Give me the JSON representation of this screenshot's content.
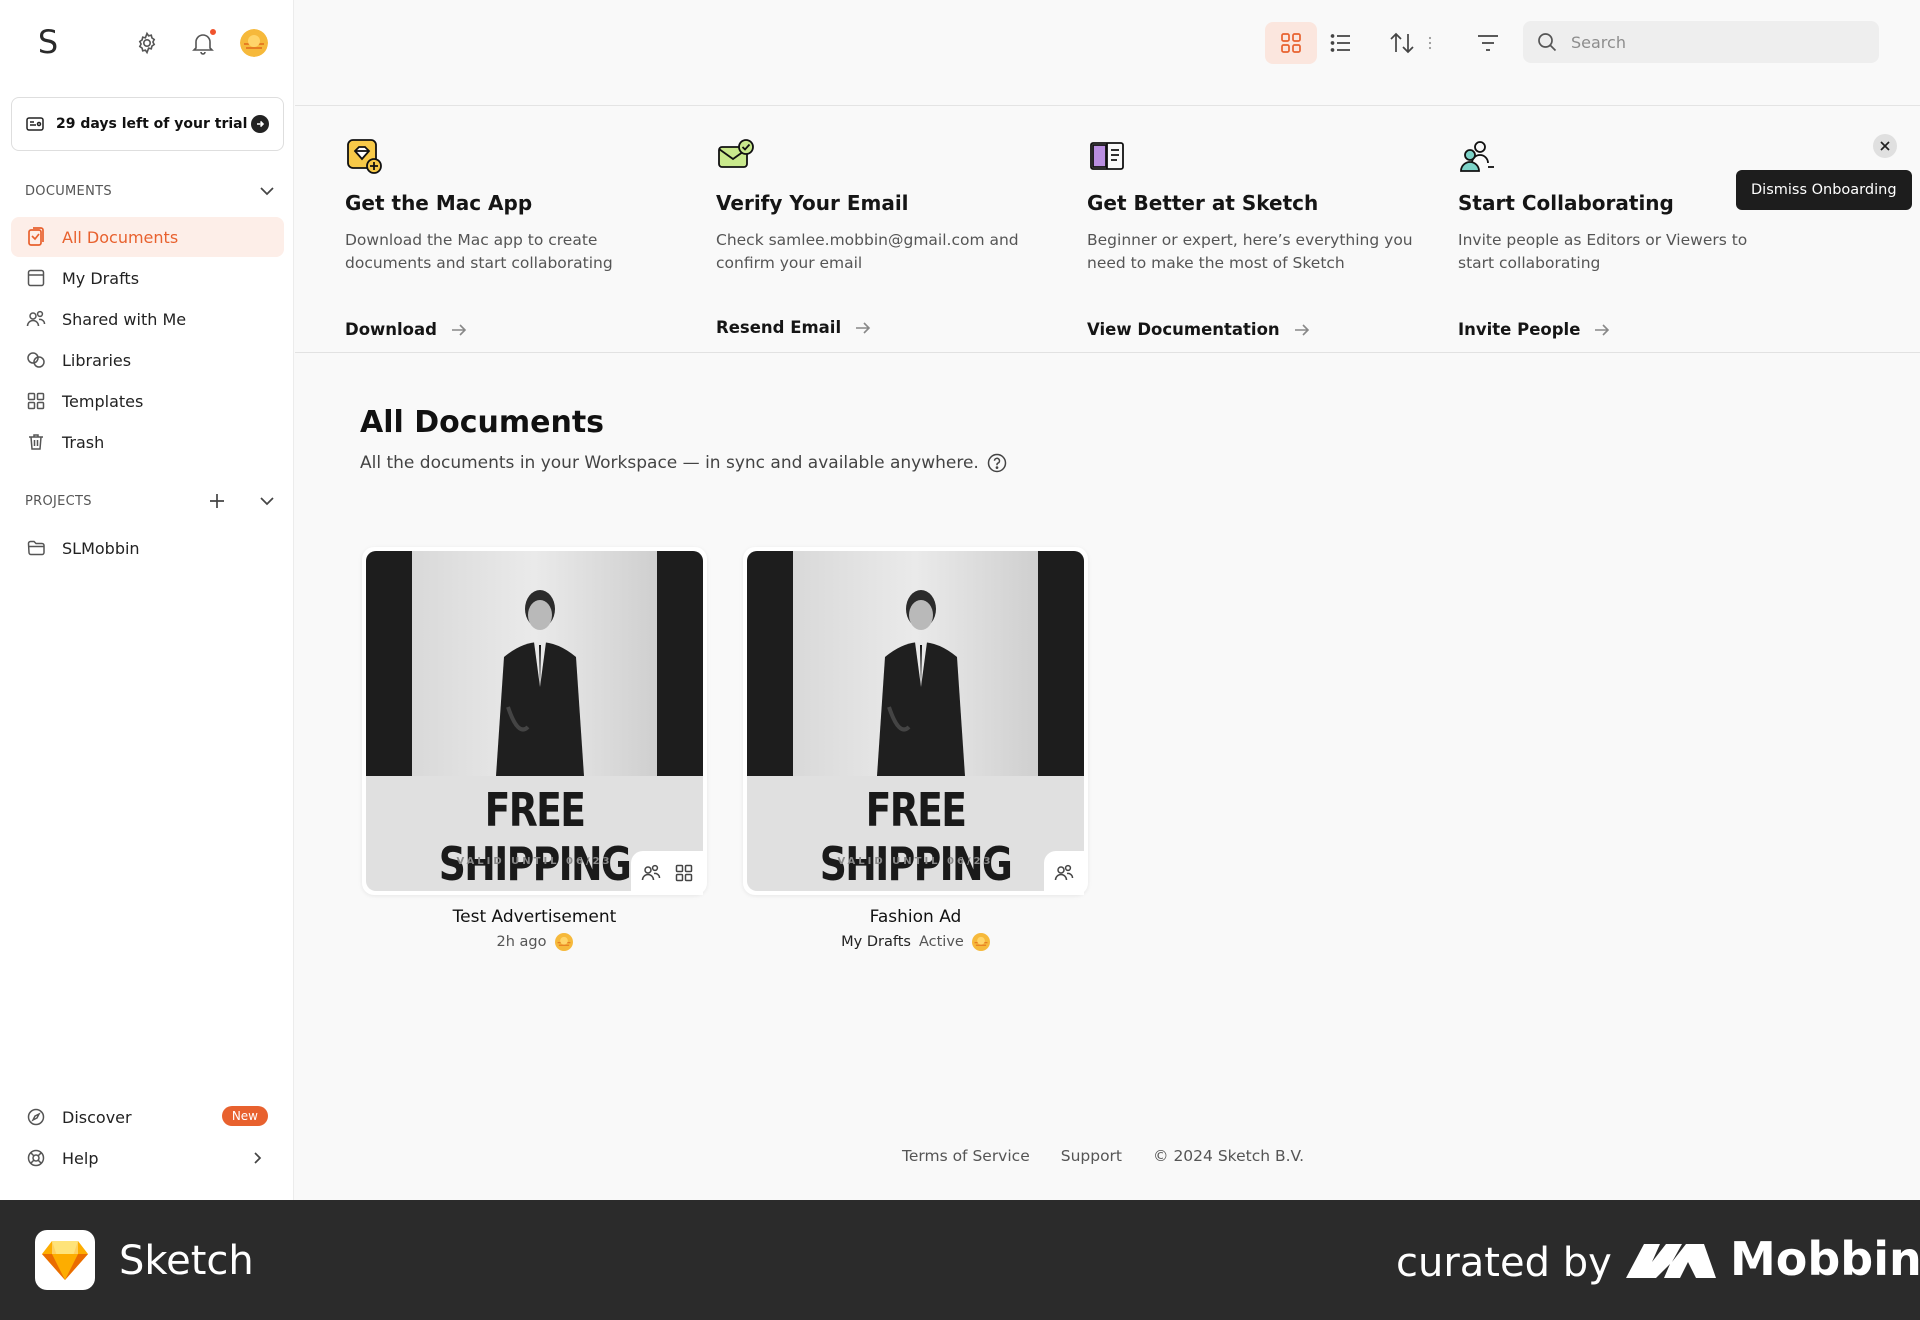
{
  "sidebar": {
    "logo": "S",
    "trial": "29 days left of your trial",
    "documents_title": "DOCUMENTS",
    "doc_items": [
      {
        "label": "All Documents",
        "icon": "document-icon",
        "active": true
      },
      {
        "label": "My Drafts",
        "icon": "drafts-icon"
      },
      {
        "label": "Shared with Me",
        "icon": "people-icon"
      },
      {
        "label": "Libraries",
        "icon": "libraries-icon"
      },
      {
        "label": "Templates",
        "icon": "grid-icon"
      },
      {
        "label": "Trash",
        "icon": "trash-icon"
      }
    ],
    "projects_title": "PROJECTS",
    "projects": [
      {
        "label": "SLMobbin",
        "icon": "folder-icon"
      }
    ],
    "discover_label": "Discover",
    "discover_badge": "New",
    "help_label": "Help"
  },
  "header": {
    "search_placeholder": "Search"
  },
  "onboarding": {
    "cards": [
      {
        "title": "Get the Mac App",
        "desc": "Download the Mac app to create documents and start collaborating",
        "link": "Download",
        "icon": "sketch-app-icon"
      },
      {
        "title": "Verify Your Email",
        "desc": "Check samlee.mobbin@gmail.com and confirm your email",
        "link": "Resend Email",
        "icon": "email-check-icon"
      },
      {
        "title": "Get Better at Sketch",
        "desc": "Beginner or expert, here’s everything you need to make the most of Sketch",
        "link": "View Documentation",
        "icon": "book-icon"
      },
      {
        "title": "Start Collaborating",
        "desc": "Invite people as Editors or Viewers to start collaborating",
        "link": "Invite People",
        "icon": "collaborate-icon"
      }
    ],
    "dismiss_tooltip": "Dismiss Onboarding"
  },
  "main": {
    "title": "All Documents",
    "subtitle": "All the documents in your Workspace — in sync and available anywhere.",
    "documents": [
      {
        "name": "Test Advertisement",
        "meta_primary": "",
        "meta_secondary": "2h ago",
        "headline": "FREE SHIPPING",
        "valid": "VALID UNTIL 06/23"
      },
      {
        "name": "Fashion Ad",
        "meta_primary": "My Drafts",
        "meta_secondary": "Active",
        "headline": "FREE SHIPPING",
        "valid": "VALID UNTIL 06/23"
      }
    ]
  },
  "footer": {
    "terms": "Terms of Service",
    "support": "Support",
    "copyright": "© 2024 Sketch B.V."
  },
  "bottombar": {
    "app_name": "Sketch",
    "curated": "curated by",
    "brand": "Mobbin"
  },
  "colors": {
    "accent": "#e8612e",
    "accent_bg": "#fdeee8",
    "dark": "#2b2b2b"
  }
}
